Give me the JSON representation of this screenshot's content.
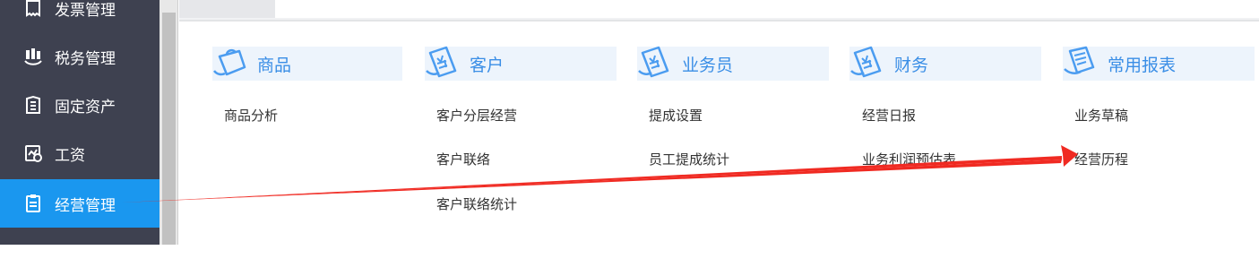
{
  "sidebar": {
    "items": [
      {
        "label": "发票管理",
        "icon": "invoice-icon"
      },
      {
        "label": "税务管理",
        "icon": "tax-icon"
      },
      {
        "label": "固定资产",
        "icon": "building-icon"
      },
      {
        "label": "工资",
        "icon": "salary-icon"
      },
      {
        "label": "经营管理",
        "icon": "clipboard-icon",
        "active": true
      }
    ],
    "active_color": "#1a97ef",
    "background": "#3e4150"
  },
  "categories": [
    {
      "title": "商品",
      "icon": "bag-icon",
      "links": [
        "商品分析"
      ]
    },
    {
      "title": "客户",
      "icon": "receipt-icon",
      "links": [
        "客户分层经营",
        "客户联络",
        "客户联络统计"
      ]
    },
    {
      "title": "业务员",
      "icon": "receipt-icon",
      "links": [
        "提成设置",
        "员工提成统计"
      ]
    },
    {
      "title": "财务",
      "icon": "receipt-icon",
      "links": [
        "经营日报",
        "业务利润预估表"
      ]
    },
    {
      "title": "常用报表",
      "icon": "report-icon",
      "links": [
        "业务草稿",
        "经营历程"
      ]
    }
  ],
  "annotation": {
    "color": "#f02a22",
    "icon": "red-arrow"
  }
}
